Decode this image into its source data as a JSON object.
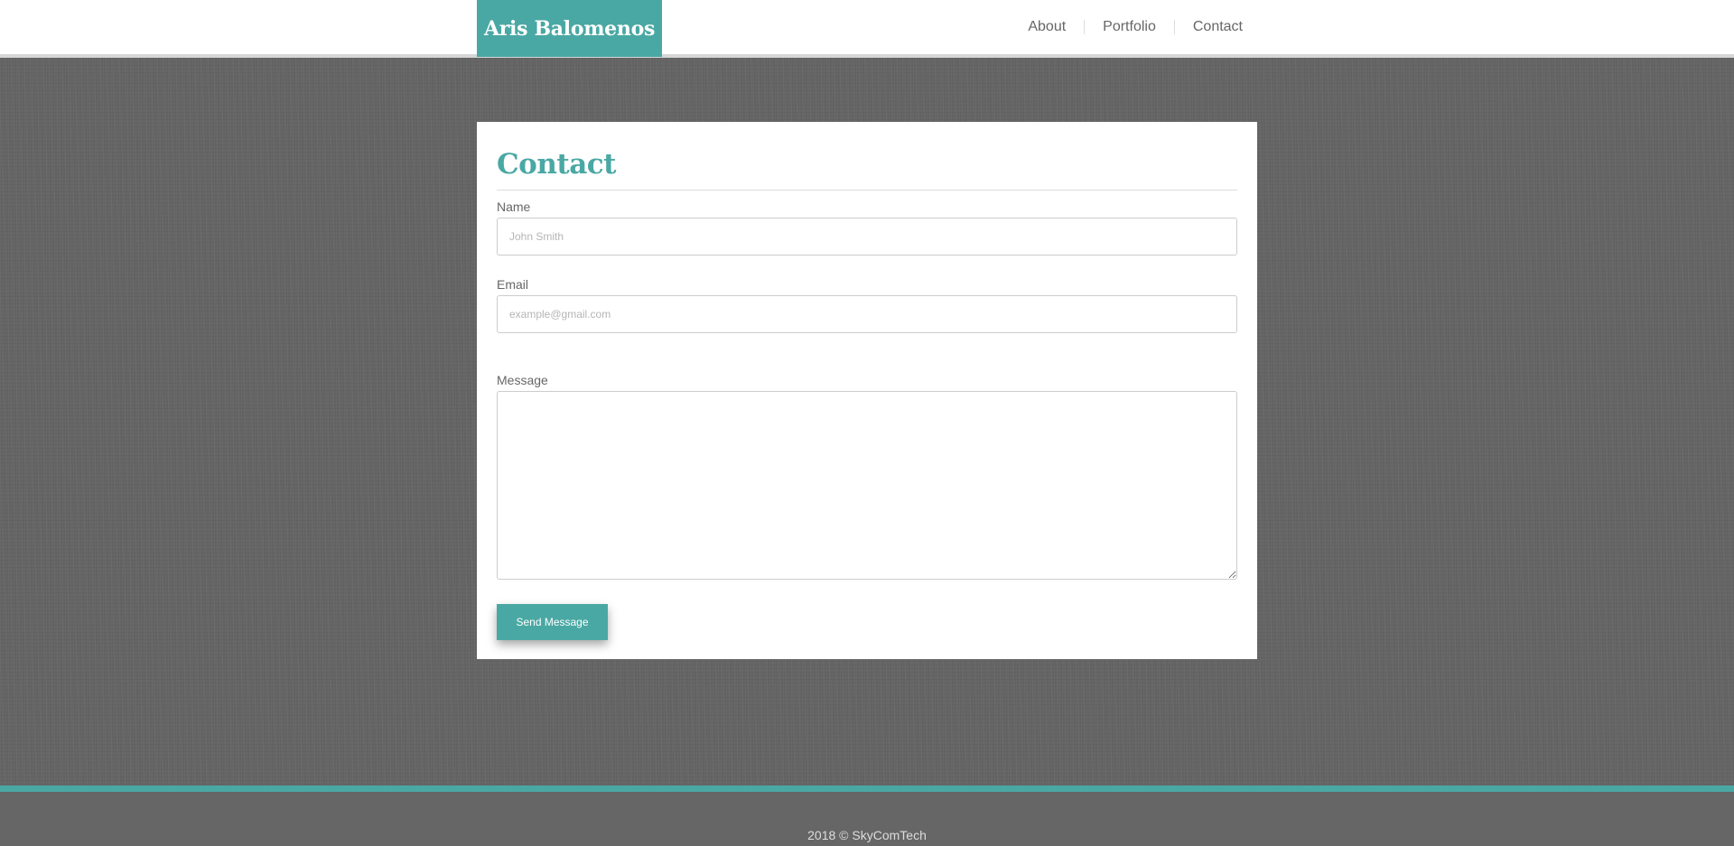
{
  "header": {
    "brand": "Aris Balomenos",
    "nav": [
      {
        "label": "About"
      },
      {
        "label": "Portfolio"
      },
      {
        "label": "Contact"
      }
    ]
  },
  "contact": {
    "title": "Contact",
    "name_label": "Name",
    "name_placeholder": "John Smith",
    "name_value": "",
    "email_label": "Email",
    "email_placeholder": "example@gmail.com",
    "email_value": "",
    "message_label": "Message",
    "message_value": "",
    "send_label": "Send Message"
  },
  "footer": {
    "text": "2018 © SkyComTech"
  },
  "colors": {
    "accent": "#4aa8a4",
    "background": "#646464",
    "footer_bg": "#666666",
    "header_bg": "#ffffff"
  }
}
